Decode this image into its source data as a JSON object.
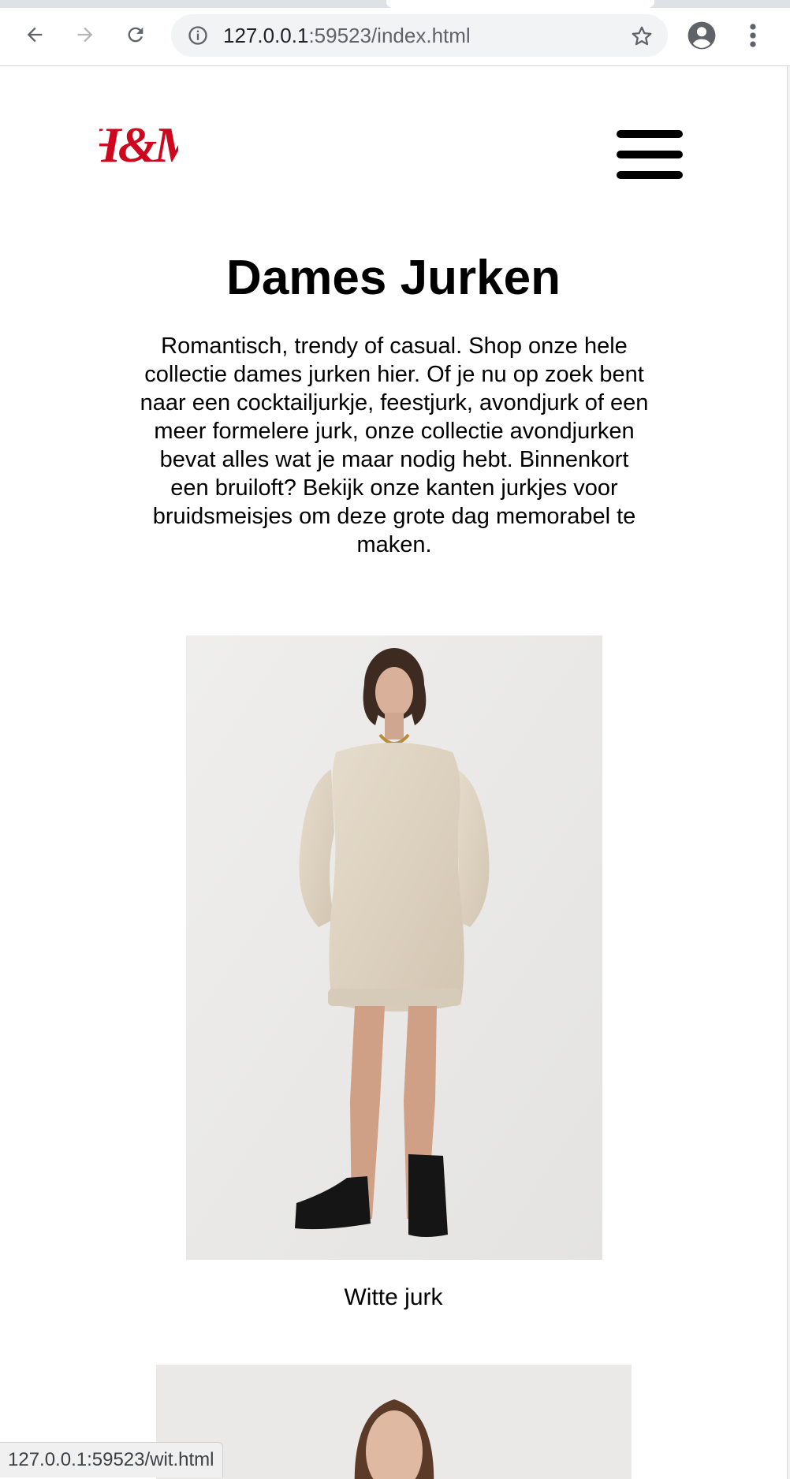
{
  "browser": {
    "url_host": "127.0.0.1",
    "url_path": ":59523/index.html",
    "status_url": "127.0.0.1:59523/wit.html",
    "icons": {
      "back": "back-arrow-icon",
      "forward": "forward-arrow-icon",
      "reload": "reload-icon",
      "info": "info-icon",
      "bookmark": "star-icon",
      "profile": "profile-icon",
      "menu": "kebab-menu-icon"
    }
  },
  "site": {
    "brand_color": "#cc071e",
    "logo_text": "H&M",
    "menu_icon": "hamburger-menu-icon"
  },
  "main": {
    "title": "Dames Jurken",
    "intro": "Romantisch, trendy of casual. Shop onze hele collectie dames jurken hier. Of je nu op zoek bent naar een cocktailjurkje, feestjurk, avondjurk of een meer formelere jurk, onze collectie avondjurken bevat alles wat je maar nodig hebt. Binnenkort een bruiloft? Bekijk onze kanten jurkjes voor bruidsmeisjes om deze grote dag memorabel te maken.",
    "products": [
      {
        "caption": "Witte jurk",
        "link": "wit.html"
      }
    ]
  }
}
